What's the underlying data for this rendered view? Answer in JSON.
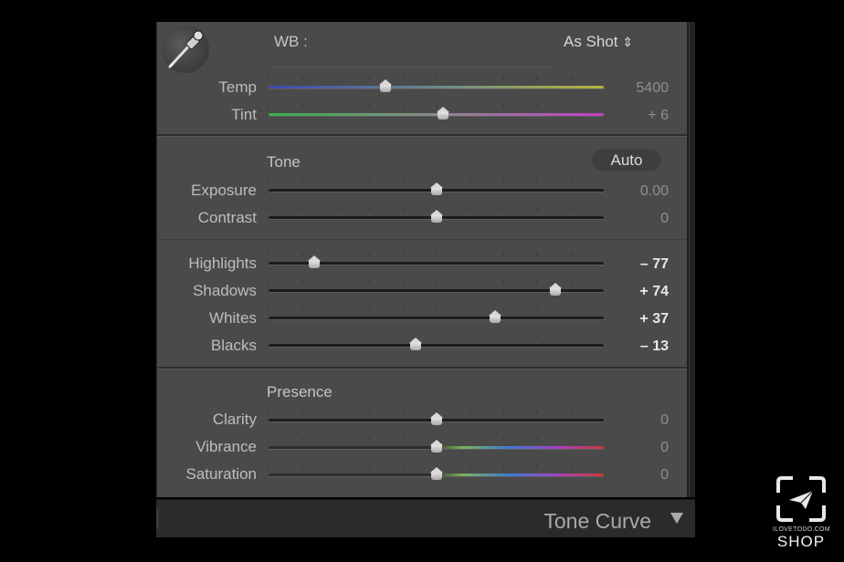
{
  "white_balance": {
    "label": "WB :",
    "preset": "As Shot",
    "preset_arrow": "⇕"
  },
  "tone": {
    "heading": "Tone",
    "auto_label": "Auto"
  },
  "presence": {
    "heading": "Presence"
  },
  "sliders": {
    "temp": {
      "label": "Temp",
      "value": "5400",
      "position": 0.35
    },
    "tint": {
      "label": "Tint",
      "value": "+ 6",
      "position": 0.52
    },
    "exposure": {
      "label": "Exposure",
      "value": "0.00",
      "position": 0.5
    },
    "contrast": {
      "label": "Contrast",
      "value": "0",
      "position": 0.5
    },
    "highlights": {
      "label": "Highlights",
      "value": "– 77",
      "position": 0.135
    },
    "shadows": {
      "label": "Shadows",
      "value": "+ 74",
      "position": 0.855
    },
    "whites": {
      "label": "Whites",
      "value": "+ 37",
      "position": 0.675
    },
    "blacks": {
      "label": "Blacks",
      "value": "– 13",
      "position": 0.44
    },
    "clarity": {
      "label": "Clarity",
      "value": "0",
      "position": 0.5
    },
    "vibrance": {
      "label": "Vibrance",
      "value": "0",
      "position": 0.5
    },
    "saturation": {
      "label": "Saturation",
      "value": "0",
      "position": 0.5
    }
  },
  "next_panel": {
    "title": "Tone Curve",
    "collapsed_arrow": "▼"
  },
  "watermark": {
    "site": "ILOVETODO.COM",
    "brand": "SHOP"
  },
  "colors": {
    "panel_bg": "#4a4a4a",
    "page_bg": "#000000",
    "thumb": "#d9d9d9"
  }
}
